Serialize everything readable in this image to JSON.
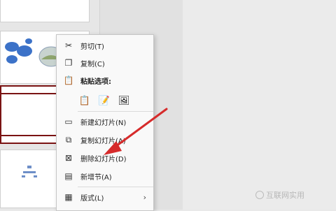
{
  "context_menu": {
    "items": [
      {
        "label": "剪切(T)",
        "icon": "scissors-icon"
      },
      {
        "label": "复制(C)",
        "icon": "copy-icon"
      },
      {
        "label": "粘贴选项:",
        "icon": "clipboard-icon"
      },
      {
        "label": "新建幻灯片(N)",
        "icon": "new-slide-icon"
      },
      {
        "label": "复制幻灯片(A)",
        "icon": "duplicate-slide-icon"
      },
      {
        "label": "删除幻灯片(D)",
        "icon": "delete-slide-icon"
      },
      {
        "label": "新增节(A)",
        "icon": "add-section-icon"
      },
      {
        "label": "版式(L)",
        "icon": "layout-icon"
      }
    ],
    "paste_options": [
      "keep-text-only-icon",
      "use-destination-theme-icon",
      "picture-icon"
    ]
  },
  "watermark": {
    "text": "互联网实用"
  },
  "colors": {
    "accent_red": "#d62b2b",
    "selected_border": "#7a1313",
    "thumb_blue": "#3c72c8"
  }
}
